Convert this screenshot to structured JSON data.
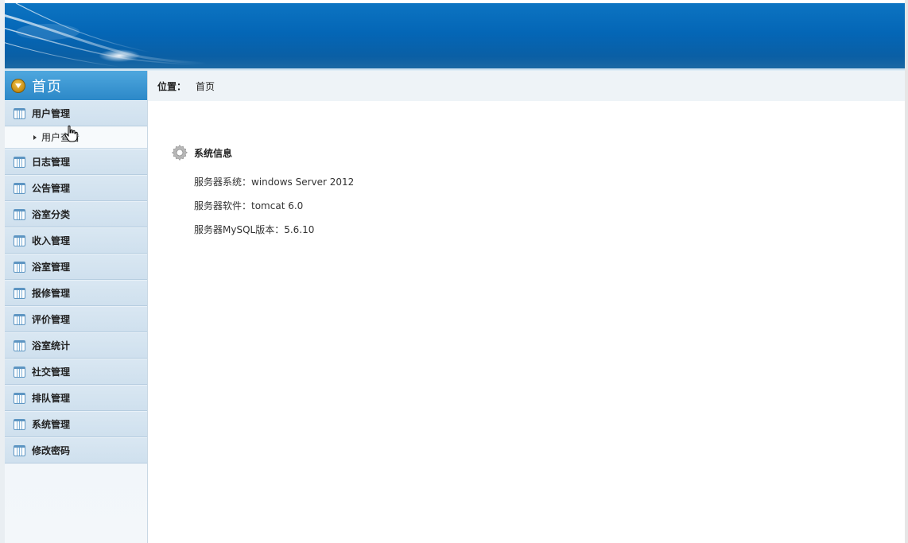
{
  "sidebar": {
    "header_title": "首页",
    "items": [
      {
        "label": "用户管理",
        "icon": "calendar-icon",
        "expanded": true,
        "children": [
          {
            "label": "用户查看"
          }
        ]
      },
      {
        "label": "日志管理",
        "icon": "calendar-icon"
      },
      {
        "label": "公告管理",
        "icon": "calendar-icon"
      },
      {
        "label": "浴室分类",
        "icon": "calendar-icon"
      },
      {
        "label": "收入管理",
        "icon": "calendar-icon"
      },
      {
        "label": "浴室管理",
        "icon": "calendar-icon"
      },
      {
        "label": "报修管理",
        "icon": "calendar-icon"
      },
      {
        "label": "评价管理",
        "icon": "calendar-icon"
      },
      {
        "label": "浴室统计",
        "icon": "calendar-icon"
      },
      {
        "label": "社交管理",
        "icon": "calendar-icon"
      },
      {
        "label": "排队管理",
        "icon": "calendar-icon"
      },
      {
        "label": "系统管理",
        "icon": "calendar-icon"
      },
      {
        "label": "修改密码",
        "icon": "calendar-icon"
      }
    ]
  },
  "breadcrumb": {
    "label": "位置：",
    "current": "首页"
  },
  "system_info": {
    "title": "系统信息",
    "lines": [
      "服务器系统：windows Server 2012",
      "服务器软件：tomcat 6.0",
      "服务器MySQL版本：5.6.10"
    ]
  },
  "colors": {
    "banner": "#0466b6",
    "sidebar_header": "#2c88c8",
    "menu_item": "#d3e3f0",
    "breadcrumb_bg": "#eef3f7"
  }
}
